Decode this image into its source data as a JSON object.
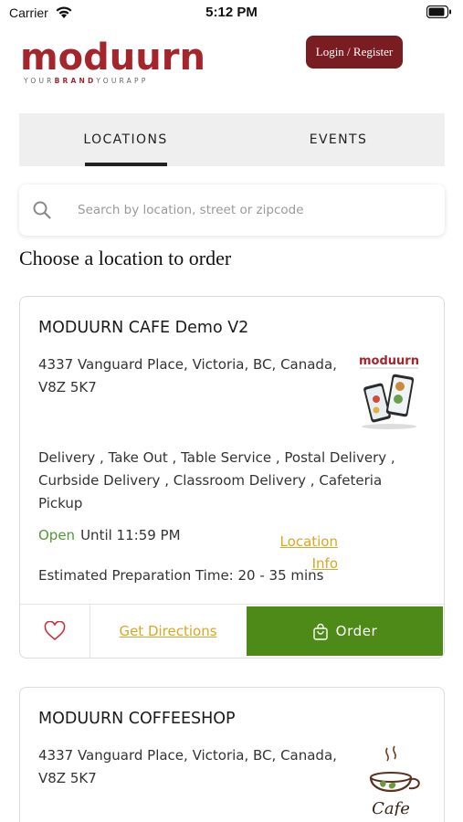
{
  "status_bar": {
    "carrier": "Carrier",
    "time": "5:12 PM"
  },
  "header": {
    "brand_name": "moduurn",
    "brand_tagline_1": "YOUR",
    "brand_tagline_2": "BRAND",
    "brand_tagline_3": "YOURAPP",
    "login_label": "Login / Register"
  },
  "tabs": [
    {
      "label": "LOCATIONS",
      "active": true
    },
    {
      "label": "EVENTS",
      "active": false
    }
  ],
  "search": {
    "placeholder": "Search by location, street or zipcode"
  },
  "section_title": "Choose a location to order",
  "locations": [
    {
      "name": "MODUURN CAFE Demo V2",
      "address": "4337 Vanguard Place, Victoria, BC, Canada, V8Z 5K7",
      "services": "Delivery , Take Out , Table Service , Postal Delivery , Curbside Delivery , Classroom Delivery , Cafeteria Pickup",
      "status": "Open",
      "hours": "Until 11:59 PM",
      "location_info_label": "Location Info",
      "prep_time": "Estimated Preparation Time: 20 - 35 mins",
      "directions_label": "Get Directions",
      "order_label": "Order",
      "image_logo_text": "moduurn"
    },
    {
      "name": "MODUURN COFFEESHOP",
      "address": "4337 Vanguard Place, Victoria, BC, Canada, V8Z 5K7",
      "image_text": "Cafe"
    }
  ],
  "colors": {
    "brand": "#a4262c",
    "login_bg": "#7a1d22",
    "open": "#4e9a32",
    "link": "#d8a822",
    "order_bg": "#4d8a17"
  }
}
